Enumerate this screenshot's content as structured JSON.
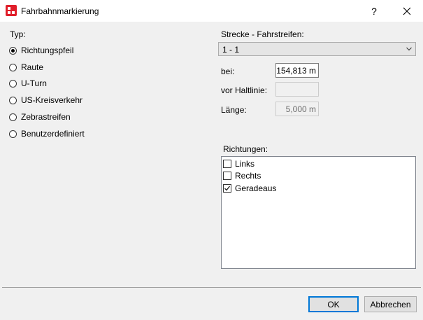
{
  "window": {
    "title": "Fahrbahnmarkierung",
    "help_label": "?",
    "icon": "app-logo-icon",
    "accent_color": "#e01e2a"
  },
  "typ": {
    "label": "Typ:",
    "options": [
      {
        "label": "Richtungspfeil",
        "checked": true
      },
      {
        "label": "Raute",
        "checked": false
      },
      {
        "label": "U-Turn",
        "checked": false
      },
      {
        "label": "US-Kreisverkehr",
        "checked": false
      },
      {
        "label": "Zebrastreifen",
        "checked": false
      },
      {
        "label": "Benutzerdefiniert",
        "checked": false
      }
    ]
  },
  "strecke": {
    "label": "Strecke - Fahrstreifen:",
    "selected": "1 - 1"
  },
  "fields": {
    "bei": {
      "label": "bei:",
      "value": "154,813 m"
    },
    "vor_haltlinie": {
      "label": "vor Haltlinie:",
      "value": ""
    },
    "laenge": {
      "label": "Länge:",
      "value": "5,000 m"
    }
  },
  "richtungen": {
    "label": "Richtungen:",
    "items": [
      {
        "label": "Links",
        "checked": false
      },
      {
        "label": "Rechts",
        "checked": false
      },
      {
        "label": "Geradeaus",
        "checked": true
      }
    ]
  },
  "buttons": {
    "ok": "OK",
    "cancel": "Abbrechen"
  }
}
